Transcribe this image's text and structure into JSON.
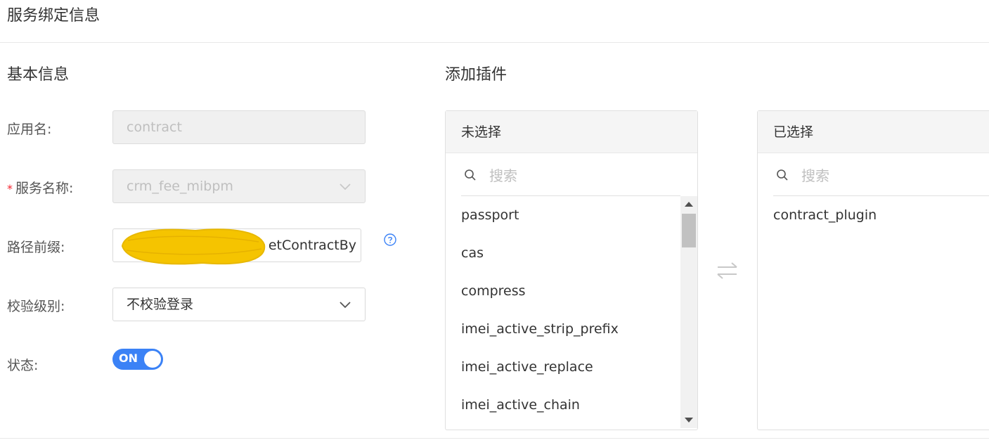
{
  "page": {
    "title": "服务绑定信息"
  },
  "basic": {
    "section_title": "基本信息",
    "app_name": {
      "label": "应用名:",
      "value": "contract"
    },
    "service_name": {
      "required_mark": "*",
      "label": "服务名称:",
      "value": "crm_fee_mibpm"
    },
    "path_prefix": {
      "label": "路径前缀:",
      "value": "etContractBy",
      "help_icon": "question-circle-icon"
    },
    "check_level": {
      "label": "校验级别:",
      "value": "不校验登录"
    },
    "status": {
      "label": "状态:",
      "toggle_text": "ON",
      "on": true
    }
  },
  "plugins": {
    "section_title": "添加插件",
    "unselected": {
      "header": "未选择",
      "search_placeholder": "搜索",
      "items": [
        "passport",
        "cas",
        "compress",
        "imei_active_strip_prefix",
        "imei_active_replace",
        "imei_active_chain"
      ]
    },
    "selected": {
      "header": "已选择",
      "search_placeholder": "搜索",
      "items": [
        "contract_plugin"
      ]
    }
  },
  "colors": {
    "accent": "#3b82f6",
    "required": "#f5222d",
    "redaction": "#f5c400"
  }
}
